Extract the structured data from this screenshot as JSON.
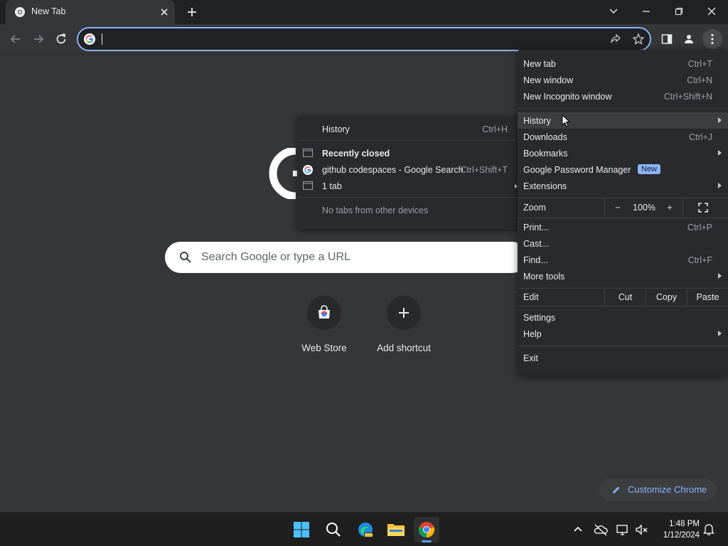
{
  "browser": {
    "tab_title": "New Tab"
  },
  "ntp": {
    "search_placeholder": "Search Google or type a URL",
    "shortcuts": [
      {
        "label": "Web Store"
      },
      {
        "label": "Add shortcut"
      }
    ],
    "customize_label": "Customize Chrome"
  },
  "history_submenu": {
    "history": {
      "label": "History",
      "shortcut": "Ctrl+H"
    },
    "recently_closed": "Recently closed",
    "closed_items": [
      {
        "label": "github codespaces - Google Search",
        "shortcut": "Ctrl+Shift+T"
      },
      {
        "label": "1 tab"
      }
    ],
    "other_devices": "No tabs from other devices"
  },
  "menu": {
    "new_tab": {
      "label": "New tab",
      "shortcut": "Ctrl+T"
    },
    "new_window": {
      "label": "New window",
      "shortcut": "Ctrl+N"
    },
    "new_incognito": {
      "label": "New Incognito window",
      "shortcut": "Ctrl+Shift+N"
    },
    "history": {
      "label": "History"
    },
    "downloads": {
      "label": "Downloads",
      "shortcut": "Ctrl+J"
    },
    "bookmarks": {
      "label": "Bookmarks"
    },
    "password_manager": {
      "label": "Google Password Manager",
      "badge": "New"
    },
    "extensions": {
      "label": "Extensions"
    },
    "zoom": {
      "label": "Zoom",
      "minus": "−",
      "value": "100%",
      "plus": "+"
    },
    "print": {
      "label": "Print...",
      "shortcut": "Ctrl+P"
    },
    "cast": {
      "label": "Cast..."
    },
    "find": {
      "label": "Find...",
      "shortcut": "Ctrl+F"
    },
    "more_tools": {
      "label": "More tools"
    },
    "edit": {
      "label": "Edit",
      "cut": "Cut",
      "copy": "Copy",
      "paste": "Paste"
    },
    "settings": {
      "label": "Settings"
    },
    "help": {
      "label": "Help"
    },
    "exit": {
      "label": "Exit"
    }
  },
  "taskbar": {
    "time": "1:48 PM",
    "date": "1/12/2024"
  },
  "colors": {
    "accent": "#8ab4f8",
    "background": "#35363a",
    "menu_bg": "#292a2d"
  }
}
